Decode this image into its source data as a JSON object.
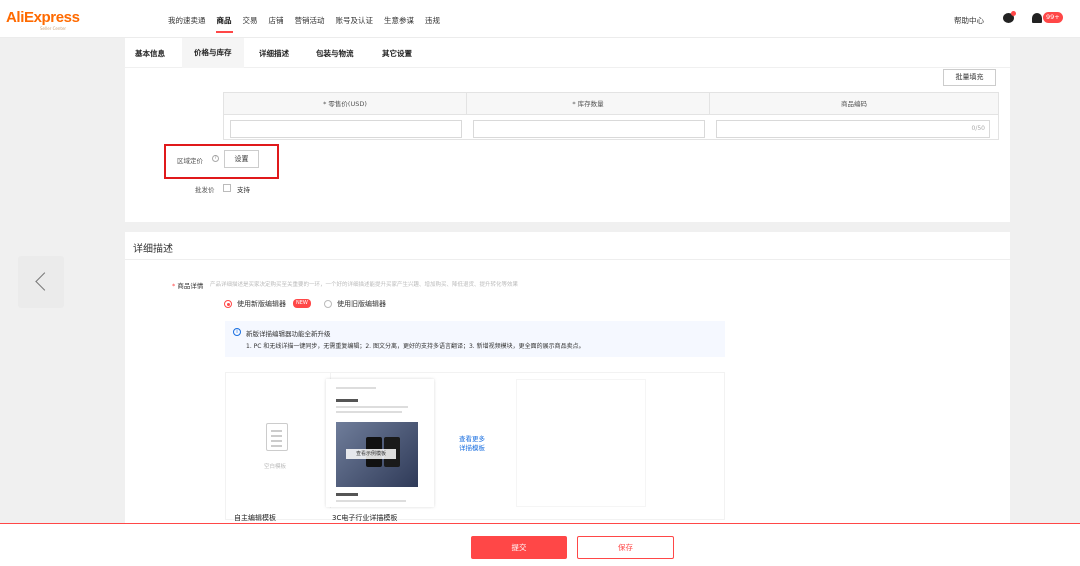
{
  "brand": {
    "logo": "AliExpress",
    "sub": "Seller Center"
  },
  "nav": {
    "items": [
      "我的速卖通",
      "商品",
      "交易",
      "店铺",
      "营销活动",
      "账号及认证",
      "生意参谋",
      "违规"
    ],
    "active": "商品",
    "help": "帮助中心",
    "notify_badge": "99+"
  },
  "tabs": {
    "items": [
      "基本信息",
      "价格与库存",
      "详细描述",
      "包装与物流",
      "其它设置"
    ],
    "active": "价格与库存"
  },
  "price": {
    "batch_fill": "批量填充",
    "columns": [
      "* 零售价(USD)",
      "* 库存数量",
      "商品编码"
    ],
    "code_counter": "0/50",
    "region_label": "区域定价",
    "region_help": "?",
    "set_button": "设置",
    "wholesale_label": "批发价",
    "wholesale_option": "支持"
  },
  "detail": {
    "title": "详细描述",
    "field_star": "*",
    "field_label": "商品详情",
    "hint": "产品详细描述是买家决定购买至关重要的一环，一个好的详细描述能提升买家产生兴趣、增加购买、降低退货、提升转化等效果",
    "editors": [
      {
        "label": "使用新版编辑器",
        "selected": true,
        "badge": "NEW"
      },
      {
        "label": "使用旧版编辑器",
        "selected": false
      }
    ],
    "notice_icon": "i",
    "notice_title": "新版详描编辑器功能全新升级",
    "notice_text": "1. PC 和无线详描一键同步，无需重复编辑；2. 图文分离，更好的支持多语言翻译；3. 新增视频模块，更全面的展示商品卖点。",
    "templates": [
      {
        "label": "自主编辑模板",
        "caption": "空白模板"
      },
      {
        "label": "3C电子行业详描模板",
        "overlay": "查看示例模板"
      }
    ],
    "more_link": [
      "查看更多",
      "详描模板"
    ]
  },
  "footer": {
    "submit": "提交",
    "save": "保存"
  },
  "colors": {
    "accent": "#ff4747",
    "highlight": "#e0191b",
    "link": "#1a6fe0",
    "brand": "#ff6a00"
  }
}
